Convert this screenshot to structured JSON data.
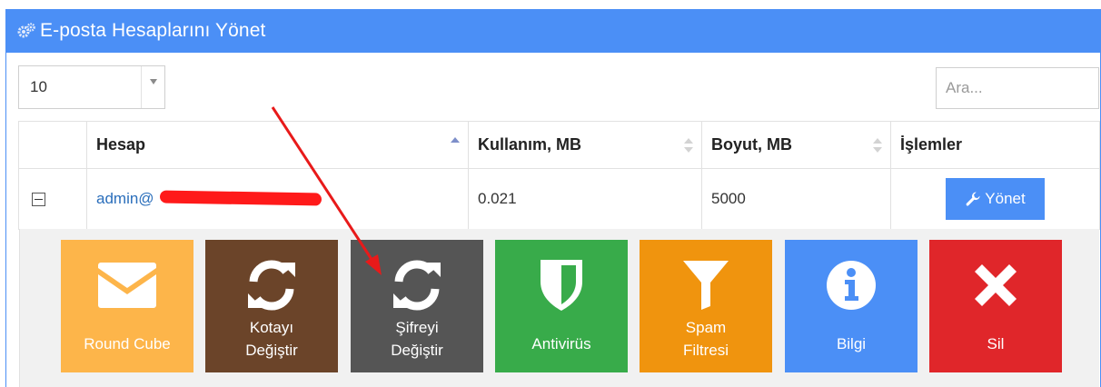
{
  "header": {
    "title": "E-posta Hesaplarını Yönet",
    "icon": "gears-icon"
  },
  "length_select": {
    "value": "10"
  },
  "search": {
    "placeholder": "Ara..."
  },
  "table": {
    "columns": [
      "",
      "Hesap",
      "Kullanım, MB",
      "Boyut, MB",
      "İşlemler"
    ],
    "rows": [
      {
        "account": "admin@",
        "usage": "0.021",
        "size": "5000",
        "action_label": "Yönet"
      }
    ]
  },
  "actions": [
    {
      "label_line1": "Round Cube",
      "label_line2": "",
      "color": "#fdb54a",
      "icon": "envelope-icon"
    },
    {
      "label_line1": "Kotayı",
      "label_line2": "Değiştir",
      "color": "#6b4429",
      "icon": "refresh-icon"
    },
    {
      "label_line1": "Şifreyi",
      "label_line2": "Değiştir",
      "color": "#555555",
      "icon": "refresh-icon"
    },
    {
      "label_line1": "Antivirüs",
      "label_line2": "",
      "color": "#38ab4a",
      "icon": "shield-icon"
    },
    {
      "label_line1": "Spam",
      "label_line2": "Filtresi",
      "color": "#f0940e",
      "icon": "filter-icon"
    },
    {
      "label_line1": "Bilgi",
      "label_line2": "",
      "color": "#4b8ff6",
      "icon": "info-icon"
    },
    {
      "label_line1": "Sil",
      "label_line2": "",
      "color": "#e0262a",
      "icon": "close-icon"
    }
  ],
  "colors": {
    "primary": "#4b8ff6",
    "annotation_arrow": "#e81a1a",
    "redaction": "#ff1a1a"
  }
}
